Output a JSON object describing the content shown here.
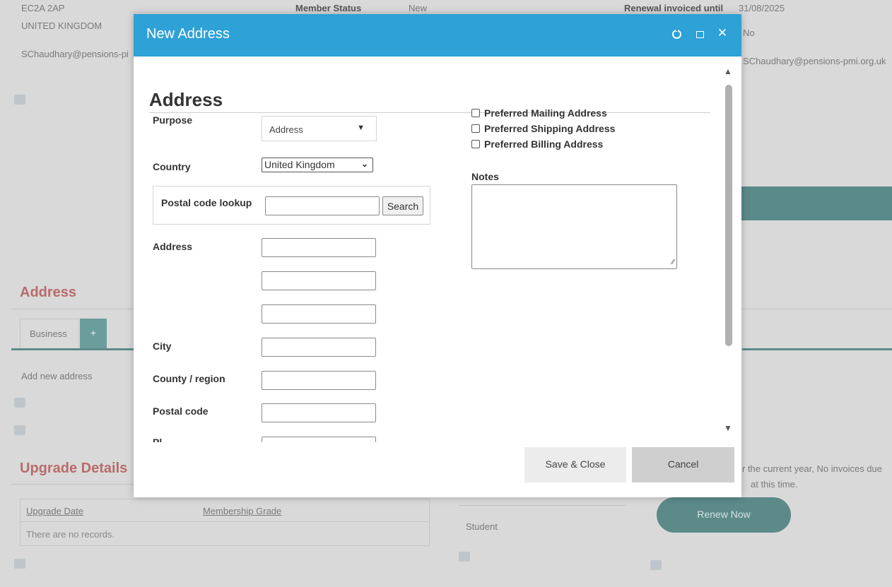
{
  "background": {
    "postcode": "EC2A 2AP",
    "country": "UNITED KINGDOM",
    "email_left": "SChaudhary@pensions-pi",
    "member_status_label": "Member Status",
    "member_status_value": "New",
    "renewal_label": "Renewal invoiced until",
    "renewal_value": "31/08/2025",
    "flag_value": "No",
    "email_right": "SChaudhary@pensions-pmi.org.uk",
    "address_section_title": "Address",
    "tab_business": "Business",
    "tab_add": "+",
    "add_new_address": "Add new address",
    "upgrade_section_title": "Upgrade Details",
    "upgrade_table": {
      "columns": [
        "Upgrade Date",
        "Membership Grade"
      ],
      "empty_text": "There are no records."
    },
    "grade_value": "Student",
    "invoice_message_line1": "r the current year, No invoices due",
    "invoice_message_line2": "at this time.",
    "renew_button": "Renew Now"
  },
  "modal": {
    "title": "New Address",
    "header_icons": [
      "refresh-icon",
      "maximize-icon",
      "close-icon"
    ],
    "close_glyph": "✕",
    "form_title": "Address",
    "purpose": {
      "label": "Purpose",
      "value": "Address"
    },
    "country": {
      "label": "Country",
      "value": "United Kingdom"
    },
    "postal_lookup": {
      "label": "Postal code lookup",
      "value": "",
      "button": "Search"
    },
    "address": {
      "label": "Address",
      "line1": "",
      "line2": "",
      "line3": ""
    },
    "city": {
      "label": "City",
      "value": ""
    },
    "county": {
      "label": "County / region",
      "value": ""
    },
    "postal_code": {
      "label": "Postal code",
      "value": ""
    },
    "phone_label_partial": "Pl",
    "checkboxes": [
      {
        "label": "Preferred Mailing Address",
        "checked": false
      },
      {
        "label": "Preferred Shipping Address",
        "checked": false
      },
      {
        "label": "Preferred Billing Address",
        "checked": false
      }
    ],
    "notes": {
      "label": "Notes",
      "value": ""
    },
    "buttons": {
      "save": "Save & Close",
      "cancel": "Cancel"
    }
  }
}
